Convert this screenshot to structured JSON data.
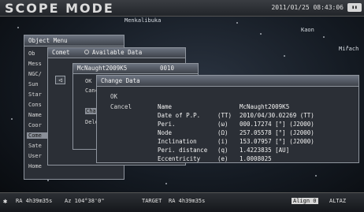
{
  "header": {
    "mode_title": "SCOPE MODE",
    "datetime": "2011/01/25 08:43:06"
  },
  "sky_labels": [
    "Menkalibuka",
    "Kaon",
    "Mirach"
  ],
  "object_menu": {
    "title": "Object Menu",
    "items": [
      "Ob",
      "Mess",
      "NGC/",
      "Sun",
      "Star",
      "Cons",
      "Name",
      "Coor",
      "Come",
      "Sate",
      "User",
      "Home"
    ]
  },
  "comet_panel": {
    "title": "Comet",
    "option": "Available Data"
  },
  "comet_list": {
    "name": "McNaught2009K5",
    "number": "0010",
    "items": [
      "OK",
      "Cancel",
      "Chan",
      "Dele"
    ]
  },
  "change_data": {
    "title": "Change Data",
    "ok": "OK",
    "cancel": "Cancel",
    "rows": [
      {
        "label": "Name",
        "unit": "",
        "value": "McNaught2009K5"
      },
      {
        "label": "Date of P.P.",
        "unit": "(TT)",
        "value": "2010/04/30.02269 (TT)"
      },
      {
        "label": "Peri.",
        "unit": "(ω)",
        "value": "000.17274 [°] (J2000)"
      },
      {
        "label": "Node",
        "unit": "(Ω)",
        "value": "257.05578 [°] (J2000)"
      },
      {
        "label": "Inclination",
        "unit": "(i)",
        "value": "153.07957 [°] (J2000)"
      },
      {
        "label": "Peri. distance",
        "unit": "(q)",
        "value": "1.4223835 [AU]"
      },
      {
        "label": "Eccentricity",
        "unit": "(e)",
        "value": "1.0008025"
      }
    ]
  },
  "footer": {
    "ra1": "RA 4h39m35s",
    "az": "Az 104°38'0\"",
    "target": "TARGET",
    "ra2": "RA 4h39m35s",
    "align": "Align 0",
    "altaz": "ALTAZ"
  }
}
